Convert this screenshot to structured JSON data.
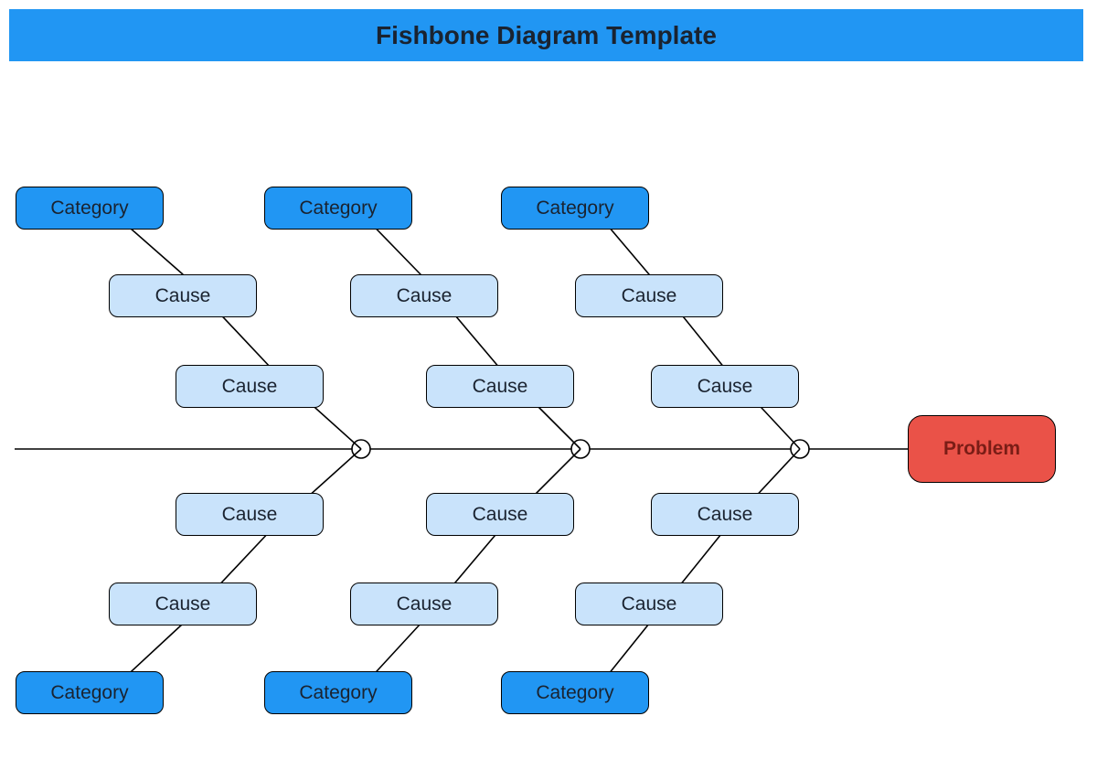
{
  "header": {
    "title": "Fishbone Diagram Template"
  },
  "colors": {
    "header_bg": "#2196F3",
    "category_bg": "#2196F3",
    "cause_bg": "#c9e3fb",
    "problem_bg": "#ea5248",
    "stroke": "#000000"
  },
  "diagram": {
    "problem_label": "Problem",
    "branches": {
      "top": [
        {
          "category_label": "Category",
          "causes": [
            "Cause",
            "Cause"
          ]
        },
        {
          "category_label": "Category",
          "causes": [
            "Cause",
            "Cause"
          ]
        },
        {
          "category_label": "Category",
          "causes": [
            "Cause",
            "Cause"
          ]
        }
      ],
      "bottom": [
        {
          "category_label": "Category",
          "causes": [
            "Cause",
            "Cause"
          ]
        },
        {
          "category_label": "Category",
          "causes": [
            "Cause",
            "Cause"
          ]
        },
        {
          "category_label": "Category",
          "causes": [
            "Cause",
            "Cause"
          ]
        }
      ]
    }
  }
}
